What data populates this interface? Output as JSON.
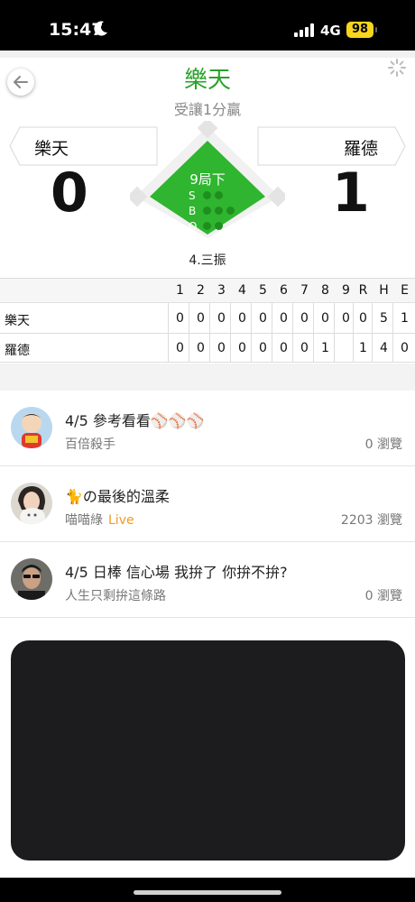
{
  "status_bar": {
    "time": "15:47",
    "network": "4G",
    "battery": "98"
  },
  "header": {
    "title": "樂天",
    "subtitle": "受讓1分贏",
    "title_color": "#2aa22a"
  },
  "scoreboard": {
    "away": {
      "name": "樂天",
      "score": "0"
    },
    "home": {
      "name": "羅德",
      "score": "1"
    },
    "inning": "9局下",
    "count_labels": [
      "S",
      "B",
      "O"
    ],
    "last_play": "4.三振",
    "field_color": "#2fb52f"
  },
  "linescore": {
    "headers": [
      "1",
      "2",
      "3",
      "4",
      "5",
      "6",
      "7",
      "8",
      "9",
      "R",
      "H",
      "E"
    ],
    "rows": [
      {
        "team": "樂天",
        "cells": [
          "0",
          "0",
          "0",
          "0",
          "0",
          "0",
          "0",
          "0",
          "0",
          "0",
          "5",
          "1"
        ]
      },
      {
        "team": "羅德",
        "cells": [
          "0",
          "0",
          "0",
          "0",
          "0",
          "0",
          "0",
          "1",
          "",
          "1",
          "4",
          "0"
        ]
      }
    ]
  },
  "posts": [
    {
      "title": "4/5 參考看看⚾⚾⚾",
      "author": "百倍殺手",
      "badge": "",
      "views": "0 瀏覽",
      "avatar": "cartoon-avatar"
    },
    {
      "title": "🐈の最後的溫柔",
      "author": "喵喵綠",
      "badge": "Live",
      "views": "2203 瀏覽",
      "avatar": "person-with-cat-avatar"
    },
    {
      "title": "4/5 日棒 信心場 我拚了 你拚不拚?",
      "author": "人生只剩拚這條路",
      "badge": "",
      "views": "0 瀏覽",
      "avatar": "man-avatar"
    }
  ],
  "colors": {
    "accent": "#2aa22a",
    "live": "#f29b20"
  }
}
